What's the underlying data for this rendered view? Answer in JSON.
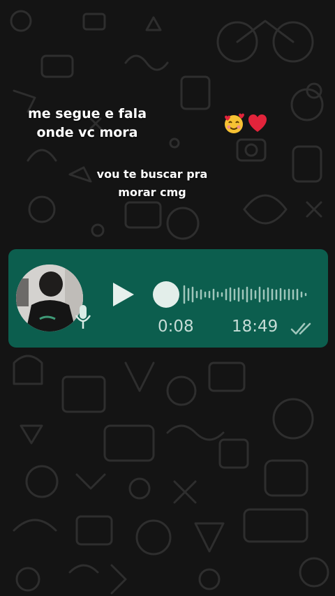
{
  "captions": {
    "line1": "me segue e fala",
    "line2": "onde vc mora",
    "line3": "vou te buscar pra",
    "line4": "morar cmg"
  },
  "emoji": {
    "icons": [
      "smiling-face-with-hearts-icon",
      "red-heart-icon"
    ]
  },
  "voice_message": {
    "duration": "0:08",
    "time": "18:49",
    "playback_progress": 0,
    "read_status": "read",
    "bubble_color": "#0c5e4e",
    "text_color": "#c5dcd6"
  }
}
